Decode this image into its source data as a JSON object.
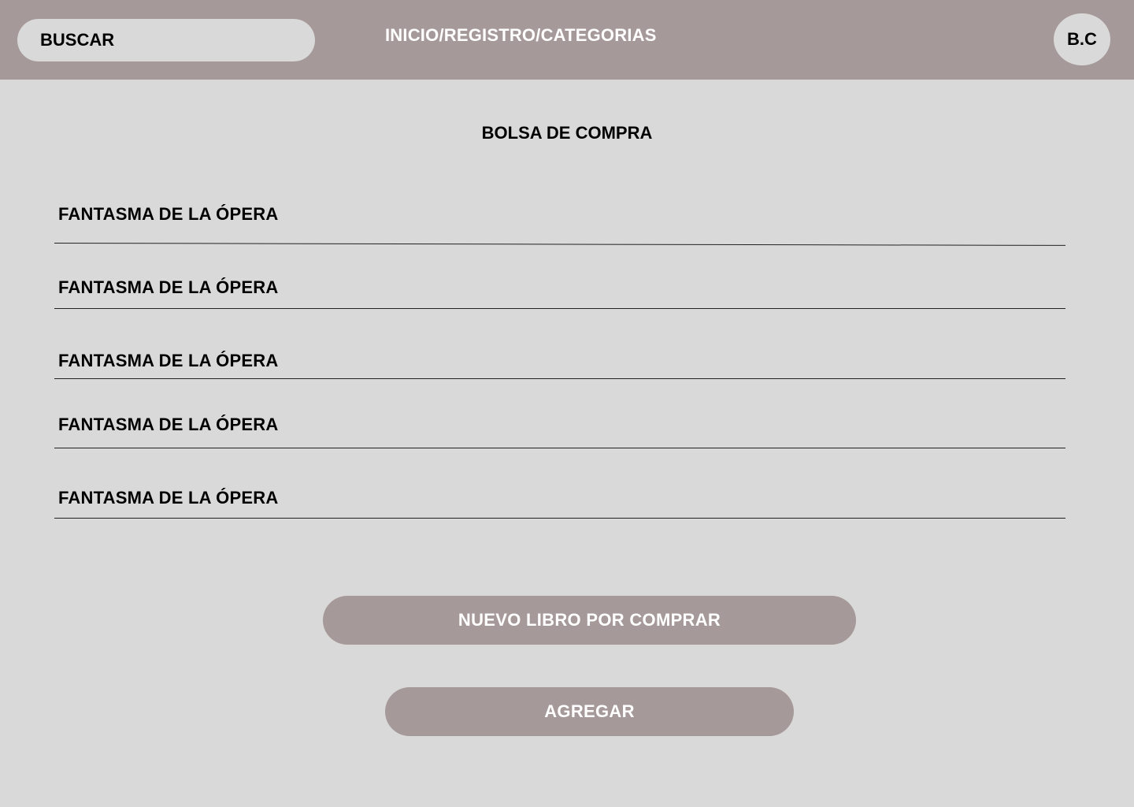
{
  "header": {
    "search_label": "BUSCAR",
    "nav": {
      "inicio": "INICIO",
      "sep1": "/",
      "registro": "REGISTRO",
      "sep2": "/",
      "categorias": "CATEGORIAS"
    },
    "avatar_initials": "B.C"
  },
  "main": {
    "title": "BOLSA DE COMPRA",
    "items": [
      {
        "label": "FANTASMA DE LA ÓPERA"
      },
      {
        "label": "FANTASMA DE LA ÓPERA"
      },
      {
        "label": "FANTASMA DE LA ÓPERA"
      },
      {
        "label": "FANTASMA DE LA ÓPERA"
      },
      {
        "label": "FANTASMA DE LA ÓPERA"
      }
    ],
    "new_book_button": "NUEVO LIBRO POR COMPRAR",
    "add_button": "AGREGAR"
  },
  "colors": {
    "background": "#d9d9d9",
    "accent": "#a69999",
    "text": "#000000",
    "button_text": "#ffffff"
  }
}
